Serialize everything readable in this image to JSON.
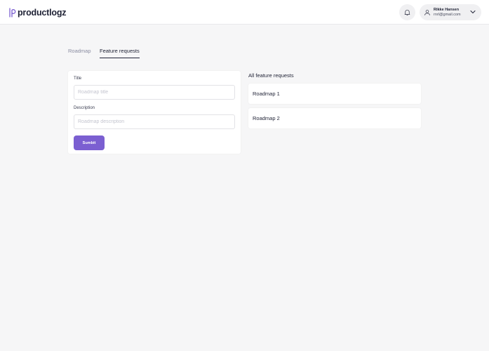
{
  "header": {
    "logo_text": "productlogz",
    "user": {
      "name": "Rikke Hansen",
      "email": "rnrl@gmail.com"
    }
  },
  "tabs": [
    {
      "label": "Roadmap",
      "active": false
    },
    {
      "label": "Feature requests",
      "active": true
    }
  ],
  "form": {
    "title_label": "Title",
    "title_placeholder": "Roadmap title",
    "description_label": "Description",
    "description_placeholder": "Roadmap description",
    "submit_label": "Sumbit"
  },
  "list": {
    "title": "All feature requests",
    "items": [
      {
        "label": "Roadmap 1"
      },
      {
        "label": "Roadmap 2"
      }
    ]
  },
  "colors": {
    "accent": "#7b5fd1",
    "text": "#1f2235",
    "background": "#f6f6f7"
  },
  "icons": {
    "logo": "p-logo-icon",
    "notifications": "bell-icon",
    "avatar": "user-icon",
    "menu": "chevron-down-icon"
  }
}
